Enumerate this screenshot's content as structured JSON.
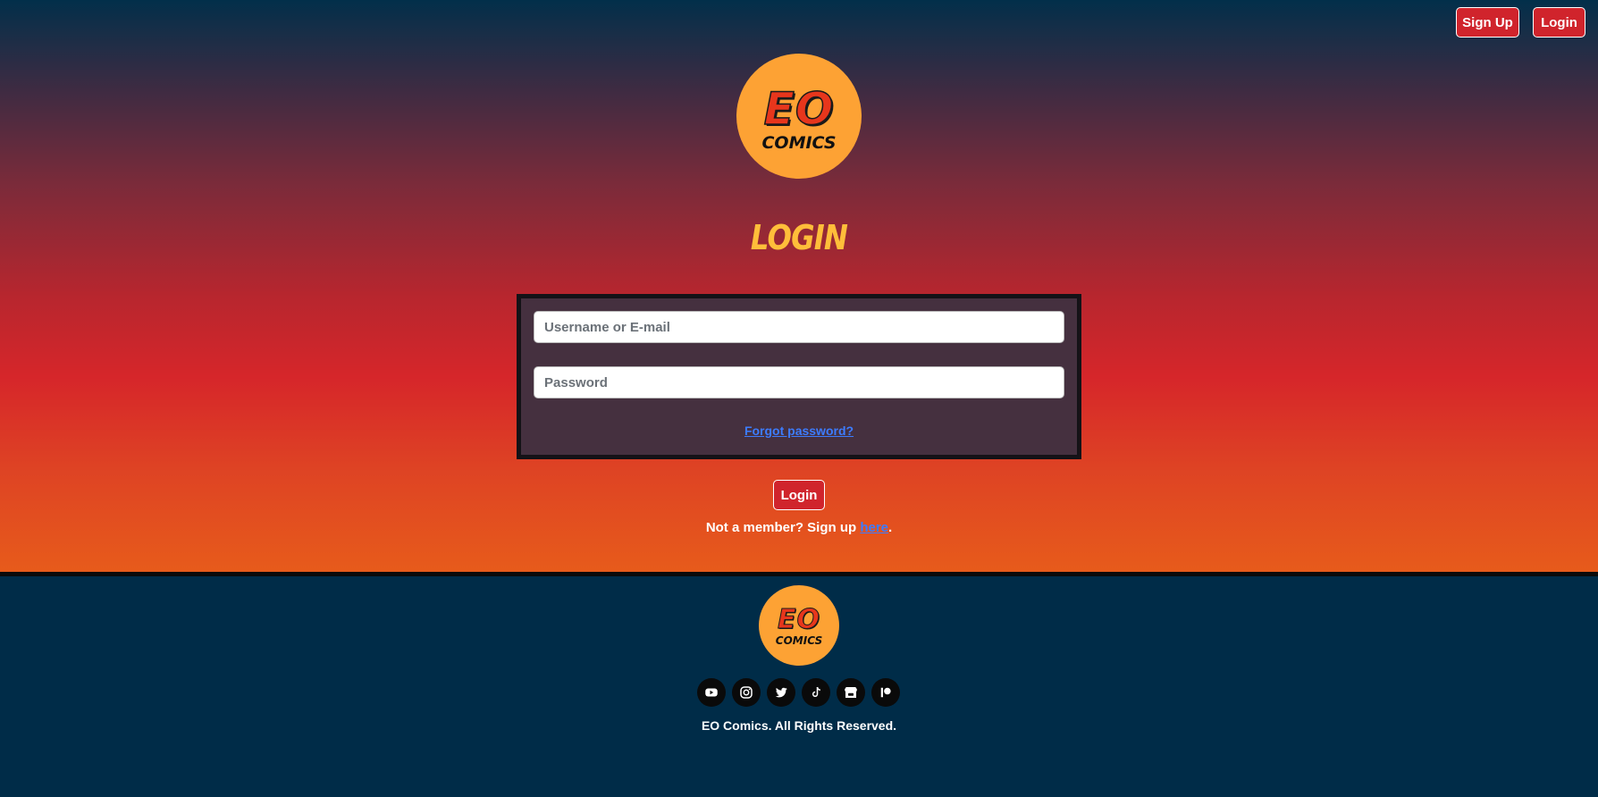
{
  "header": {
    "signup_label": "Sign Up",
    "login_label": "Login"
  },
  "logo": {
    "line1": "EO",
    "line2": "COMICS"
  },
  "page": {
    "title": "LOGIN"
  },
  "form": {
    "username_placeholder": "Username or E-mail",
    "password_placeholder": "Password",
    "forgot_label": "Forgot password?",
    "submit_label": "Login",
    "member_prefix": "Not a member? Sign up ",
    "member_link": "here",
    "member_suffix": "."
  },
  "footer": {
    "socials": [
      "youtube-icon",
      "instagram-icon",
      "twitter-icon",
      "tiktok-icon",
      "itch-icon",
      "patreon-icon"
    ],
    "copyright": "EO Comics. All Rights Reserved."
  },
  "colors": {
    "primary_button": "#d0242c",
    "title": "#ffbe3a",
    "logo_bg": "#fda234",
    "footer_bg": "#002c48",
    "link": "#3d7cff"
  }
}
